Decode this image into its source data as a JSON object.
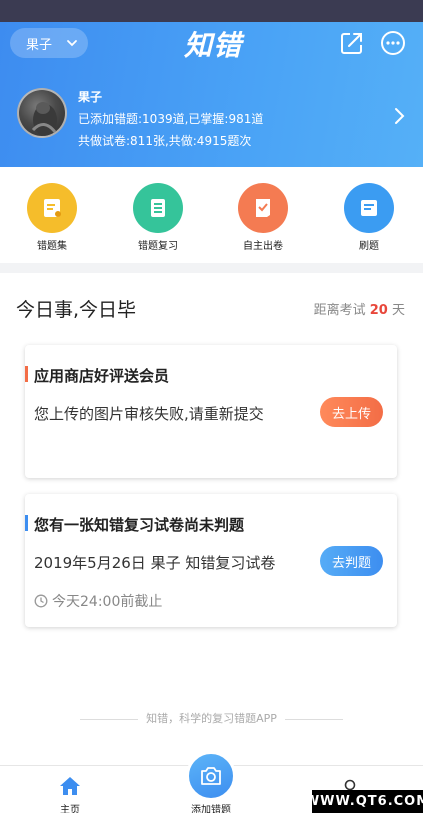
{
  "header": {
    "user_select": "果子",
    "logo": "知错",
    "icons": [
      "share-icon",
      "more-icon"
    ]
  },
  "profile": {
    "name": "果子",
    "stats_line1": "已添加错题:1039道,已掌握:981道",
    "stats_line2": "共做试卷:811张,共做:4915题次"
  },
  "quick_actions": [
    {
      "label": "错题集",
      "icon": "notebook-icon",
      "color": "#f5bd2b"
    },
    {
      "label": "错题复习",
      "icon": "review-icon",
      "color": "#35c49a"
    },
    {
      "label": "自主出卷",
      "icon": "paper-icon",
      "color": "#f47b52"
    },
    {
      "label": "刷题",
      "icon": "practice-icon",
      "color": "#3b9cf2"
    }
  ],
  "today": {
    "title": "今日事,今日毕",
    "exam_prefix": "距离考试",
    "exam_days": "20",
    "exam_suffix": "天"
  },
  "cards": [
    {
      "title": "应用商店好评送会员",
      "desc": "您上传的图片审核失败,请重新提交",
      "button": "去上传",
      "bar_color": "#f36d46"
    },
    {
      "title": "您有一张知错复习试卷尚未判题",
      "desc": "2019年5月26日 果子 知错复习试卷",
      "button": "去判题",
      "deadline": "今天24:00前截止",
      "bar_color": "#3d8ef0"
    }
  ],
  "footer_note": "知错，科学的复习错题APP",
  "bottom_nav": {
    "home": "主页",
    "add": "添加错题"
  },
  "watermark": "WWW.QT6.COM",
  "colors": {
    "accent": "#3d8ef0",
    "exam_days": "#e8473b"
  }
}
